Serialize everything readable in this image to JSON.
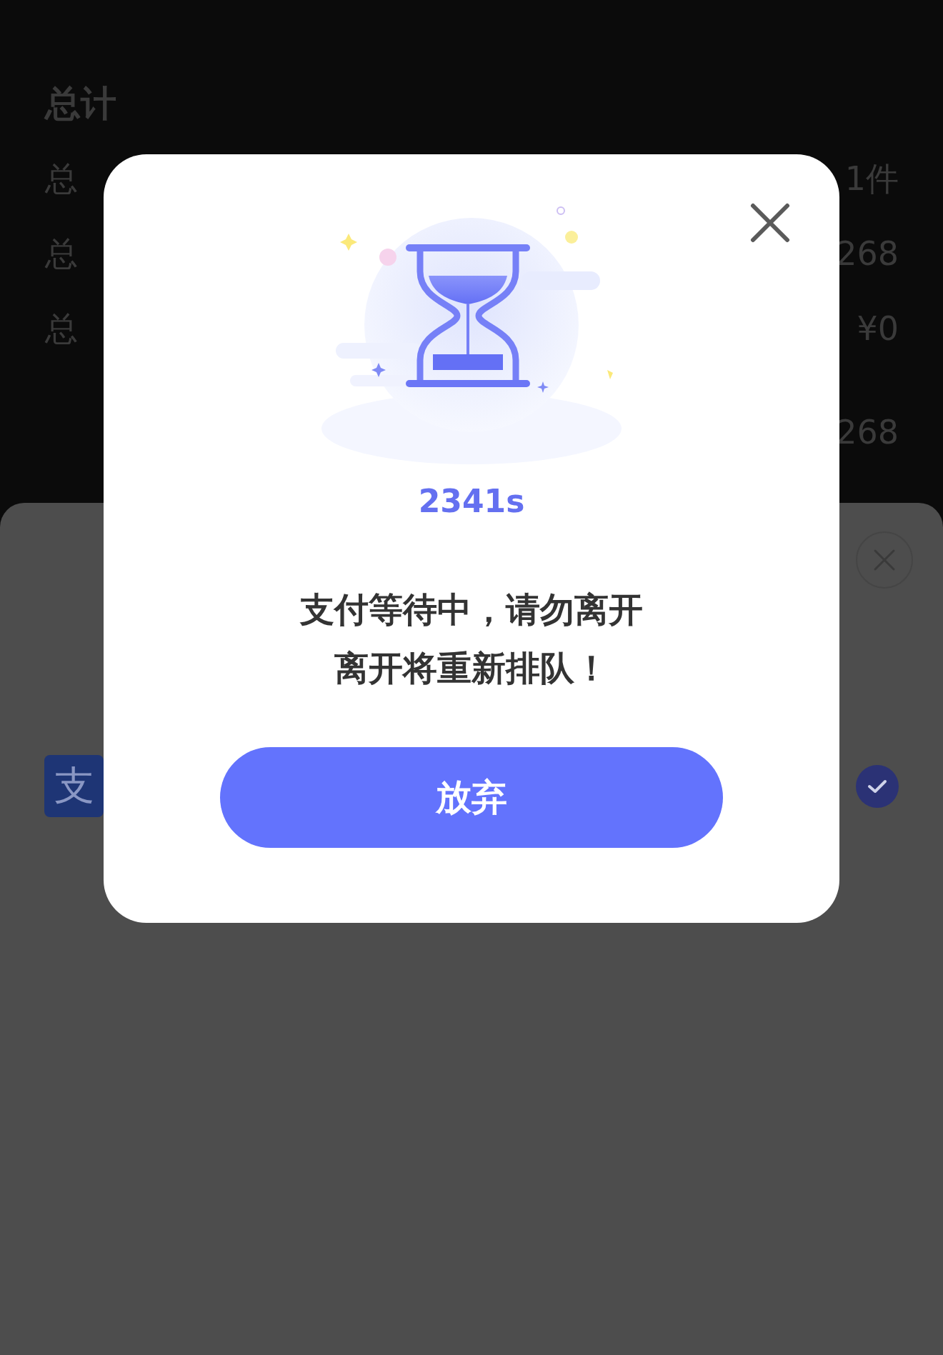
{
  "summary": {
    "title": "总计",
    "rows": [
      {
        "label": "总",
        "value": "1件"
      },
      {
        "label": "总",
        "value": "268"
      },
      {
        "label": "总",
        "value": "¥0"
      }
    ],
    "total": {
      "value": "268"
    }
  },
  "payment_sheet": {
    "methods": [
      {
        "logo": "支",
        "selected": true
      }
    ]
  },
  "dialog": {
    "countdown": "2341s",
    "message_lines": [
      "支付等待中，请勿离开",
      "离开将重新排队！"
    ],
    "button": "放弃"
  }
}
